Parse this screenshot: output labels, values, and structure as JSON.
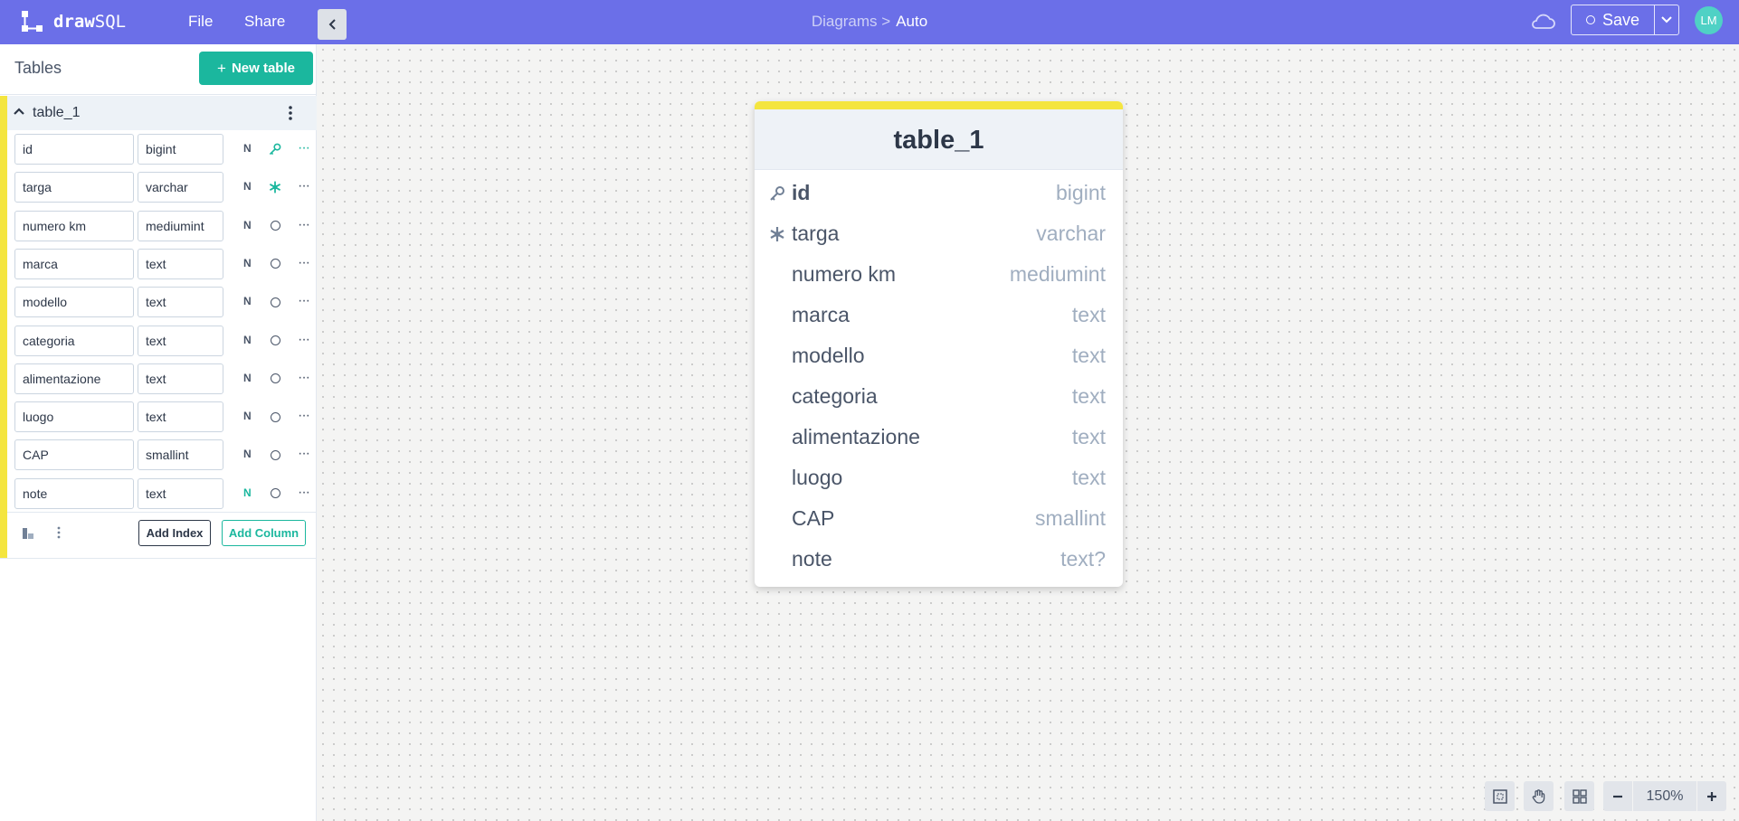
{
  "app": {
    "logo_text_bold": "draw",
    "logo_text_light": "SQL"
  },
  "menu": {
    "file": "File",
    "share": "Share"
  },
  "breadcrumb": {
    "parent": "Diagrams >",
    "current": "Auto"
  },
  "actions": {
    "save": "Save",
    "avatar_initials": "LM"
  },
  "sidebar": {
    "title": "Tables",
    "new_table": "New table",
    "table": {
      "name": "table_1",
      "columns": [
        {
          "name": "id",
          "type": "bigint",
          "nullable_label": "N",
          "nullable": false,
          "attr": "key-icon"
        },
        {
          "name": "targa",
          "type": "varchar",
          "nullable_label": "N",
          "nullable": false,
          "attr": "unique-icon"
        },
        {
          "name": "numero km",
          "type": "mediumint",
          "nullable_label": "N",
          "nullable": false,
          "attr": "none"
        },
        {
          "name": "marca",
          "type": "text",
          "nullable_label": "N",
          "nullable": false,
          "attr": "none"
        },
        {
          "name": "modello",
          "type": "text",
          "nullable_label": "N",
          "nullable": false,
          "attr": "none"
        },
        {
          "name": "categoria",
          "type": "text",
          "nullable_label": "N",
          "nullable": false,
          "attr": "none"
        },
        {
          "name": "alimentazione",
          "type": "text",
          "nullable_label": "N",
          "nullable": false,
          "attr": "none"
        },
        {
          "name": "luogo",
          "type": "text",
          "nullable_label": "N",
          "nullable": false,
          "attr": "none"
        },
        {
          "name": "CAP",
          "type": "smallint",
          "nullable_label": "N",
          "nullable": false,
          "attr": "none"
        },
        {
          "name": "note",
          "type": "text",
          "nullable_label": "N",
          "nullable": true,
          "attr": "none"
        }
      ],
      "add_index": "Add Index",
      "add_column": "Add Column"
    }
  },
  "canvas": {
    "card": {
      "title": "table_1",
      "rows": [
        {
          "name": "id",
          "type": "bigint",
          "icon": "key-icon"
        },
        {
          "name": "targa",
          "type": "varchar",
          "icon": "unique-icon"
        },
        {
          "name": "numero km",
          "type": "mediumint",
          "icon": ""
        },
        {
          "name": "marca",
          "type": "text",
          "icon": ""
        },
        {
          "name": "modello",
          "type": "text",
          "icon": ""
        },
        {
          "name": "categoria",
          "type": "text",
          "icon": ""
        },
        {
          "name": "alimentazione",
          "type": "text",
          "icon": ""
        },
        {
          "name": "luogo",
          "type": "text",
          "icon": ""
        },
        {
          "name": "CAP",
          "type": "smallint",
          "icon": ""
        },
        {
          "name": "note",
          "type": "text?",
          "icon": ""
        }
      ]
    },
    "zoom": "150%"
  },
  "colors": {
    "topbar": "#6b6fe8",
    "accent": "#1bb79e",
    "table_color": "#f4e53f"
  }
}
